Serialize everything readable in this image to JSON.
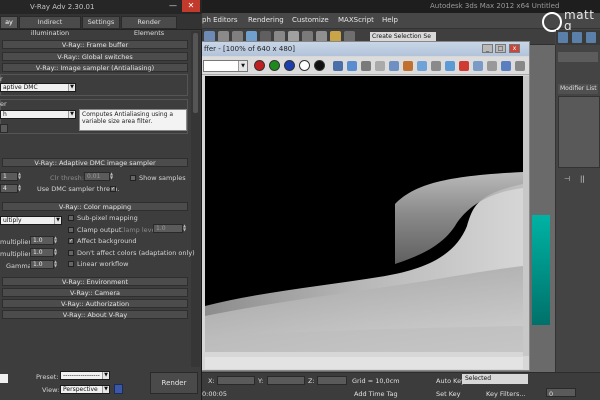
{
  "max": {
    "title": "Autodesk 3ds Max 2012 x64     Untitled",
    "menu": [
      "ph Editors",
      "Rendering",
      "Customize",
      "MAXScript",
      "Help"
    ],
    "selection_set": "Create Selection Se",
    "watermark": "matt g",
    "modifier_list": "Modifier List",
    "bottom": {
      "x_label": "X:",
      "y_label": "Y:",
      "z_label": "Z:",
      "grid": "Grid = 10,0cm",
      "auto_key": "Auto Key",
      "selected": "Selected",
      "set_key": "Set Key",
      "key_filters": "Key Filters...",
      "add_time_tag": "Add Time Tag",
      "time": "0:00:05",
      "frame": "0"
    }
  },
  "frame_buffer": {
    "title": "ffer - [100% of 640 x 480]",
    "channel_value": "",
    "min_btn": "_",
    "max_btn": "□",
    "close_btn": "x"
  },
  "vray": {
    "title": "V-Ray Adv 2.30.01",
    "close": "✕",
    "minimize": "—",
    "tabs": [
      "ay",
      "Indirect illumination",
      "Settings",
      "Render Elements"
    ],
    "rollouts": {
      "frame_buffer": "V-Ray:: Frame buffer",
      "global_switches": "V-Ray:: Global switches",
      "image_sampler": "V-Ray:: Image sampler (Antialiasing)",
      "adaptive_dmc": "V-Ray:: Adaptive DMC image sampler",
      "color_mapping": "V-Ray:: Color mapping",
      "environment": "V-Ray:: Environment",
      "camera": "V-Ray:: Camera",
      "authorization": "V-Ray:: Authorization",
      "about": "V-Ray:: About V-Ray"
    },
    "image_sampler": {
      "type_label": "r",
      "type_value": "aptive DMC",
      "filter_label": "er",
      "filter_value": "h",
      "description": "Computes Antialiasing using a variable size area filter."
    },
    "adaptive_dmc": {
      "min_value": "1",
      "max_value": "4",
      "clr_thresh_label": "Clr thresh:",
      "clr_thresh_value": "0.01",
      "show_samples": "Show samples",
      "use_dmc_thresh": "Use DMC sampler thresh.",
      "use_dmc_checked": "✓"
    },
    "color_mapping": {
      "type_value": "ultiply",
      "sub_pixel": "Sub-pixel mapping",
      "clamp_output": "Clamp output",
      "clamp_level_label": "Clamp level:",
      "clamp_level_value": "1.0",
      "affect_background": "Affect background",
      "affect_checked": "✓",
      "dont_affect": "Don't affect colors (adaptation only)",
      "linear_workflow": "Linear workflow",
      "dark_label": "multiplier:",
      "dark_value": "1.0",
      "bright_label": "multiplier:",
      "bright_value": "1.0",
      "gamma_label": "Gamma:",
      "gamma_value": "1.0"
    },
    "bottom": {
      "preset_label": "Preset:",
      "preset_value": "-----------------",
      "view_label": "View:",
      "view_value": "Perspective",
      "render": "Render"
    }
  },
  "colors": {
    "vray_bg": "#3d3d3d",
    "accent_teal": "#00b3a4",
    "close_red": "#c23a2b"
  }
}
